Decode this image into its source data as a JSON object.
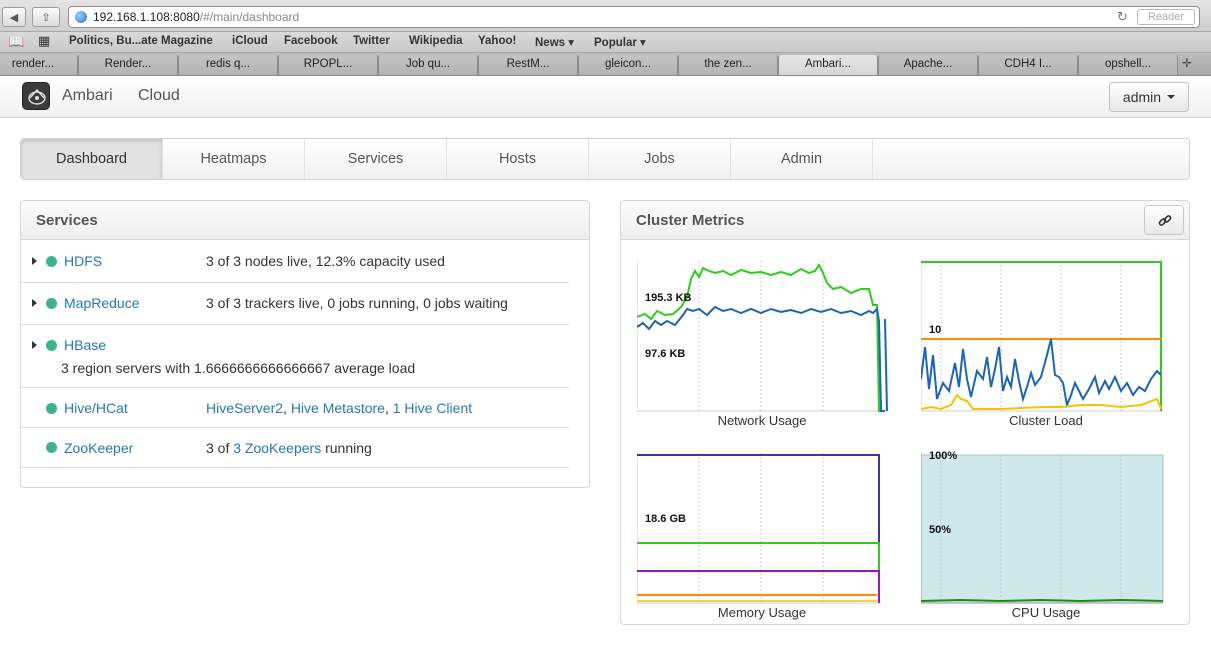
{
  "browser": {
    "url_host": "192.168.1.108:8080",
    "url_path": "/#/main/dashboard",
    "reader_label": "Reader",
    "bookmarks": [
      "Politics, Bu...ate Magazine",
      "iCloud",
      "Facebook",
      "Twitter",
      "Wikipedia",
      "Yahoo!",
      "News ▾",
      "Popular ▾"
    ],
    "tabs": [
      "render...",
      "Render...",
      "redis q...",
      "RPOPL...",
      "Job qu...",
      "RestM...",
      "gleicon...",
      "the zen...",
      "Ambari...",
      "Apache...",
      "CDH4 I...",
      "opshell..."
    ],
    "active_tab_index": 8
  },
  "app": {
    "brand": "Ambari",
    "cluster_name": "Cloud",
    "user_menu_label": "admin"
  },
  "nav": {
    "tabs": [
      "Dashboard",
      "Heatmaps",
      "Services",
      "Hosts",
      "Jobs",
      "Admin"
    ],
    "active": "Dashboard"
  },
  "services_panel": {
    "title": "Services",
    "rows": [
      {
        "name": "HDFS",
        "info": "3 of 3 nodes live, 12.3% capacity used",
        "expandable": true
      },
      {
        "name": "MapReduce",
        "info": "3 of 3 trackers live, 0 jobs running, 0 jobs waiting",
        "expandable": true
      },
      {
        "name": "HBase",
        "info": "3 region servers with 1.6666666666666667 average load",
        "expandable": true
      },
      {
        "name": "Hive/HCat",
        "links": [
          "HiveServer2",
          "Hive Metastore",
          "1 Hive Client"
        ],
        "expandable": false
      },
      {
        "name": "ZooKeeper",
        "info_prefix": "3 of ",
        "info_link": "3 ZooKeepers",
        "info_suffix": " running",
        "expandable": false
      }
    ],
    "status_color": "#3cb38f"
  },
  "metrics_panel": {
    "title": "Cluster Metrics",
    "link_icon": "link-icon",
    "charts": [
      {
        "title": "Network Usage",
        "y_labels": [
          "195.3 KB",
          "97.6 KB"
        ]
      },
      {
        "title": "Cluster Load",
        "y_labels": [
          "10"
        ]
      },
      {
        "title": "Memory Usage",
        "y_labels": [
          "18.6 GB"
        ]
      },
      {
        "title": "CPU Usage",
        "y_labels": [
          "100%",
          "50%"
        ]
      }
    ]
  },
  "colors": {
    "link": "#2577b7",
    "status_ok": "#3cb38f",
    "series_green": "#2dcc1f",
    "series_blue": "#1c64b5",
    "series_orange": "#ff8c00",
    "series_yellow": "#f5c400",
    "series_purple": "#8a1fb0",
    "series_indigo": "#4b2e9c",
    "cpu_fill": "#cfe9ea"
  }
}
